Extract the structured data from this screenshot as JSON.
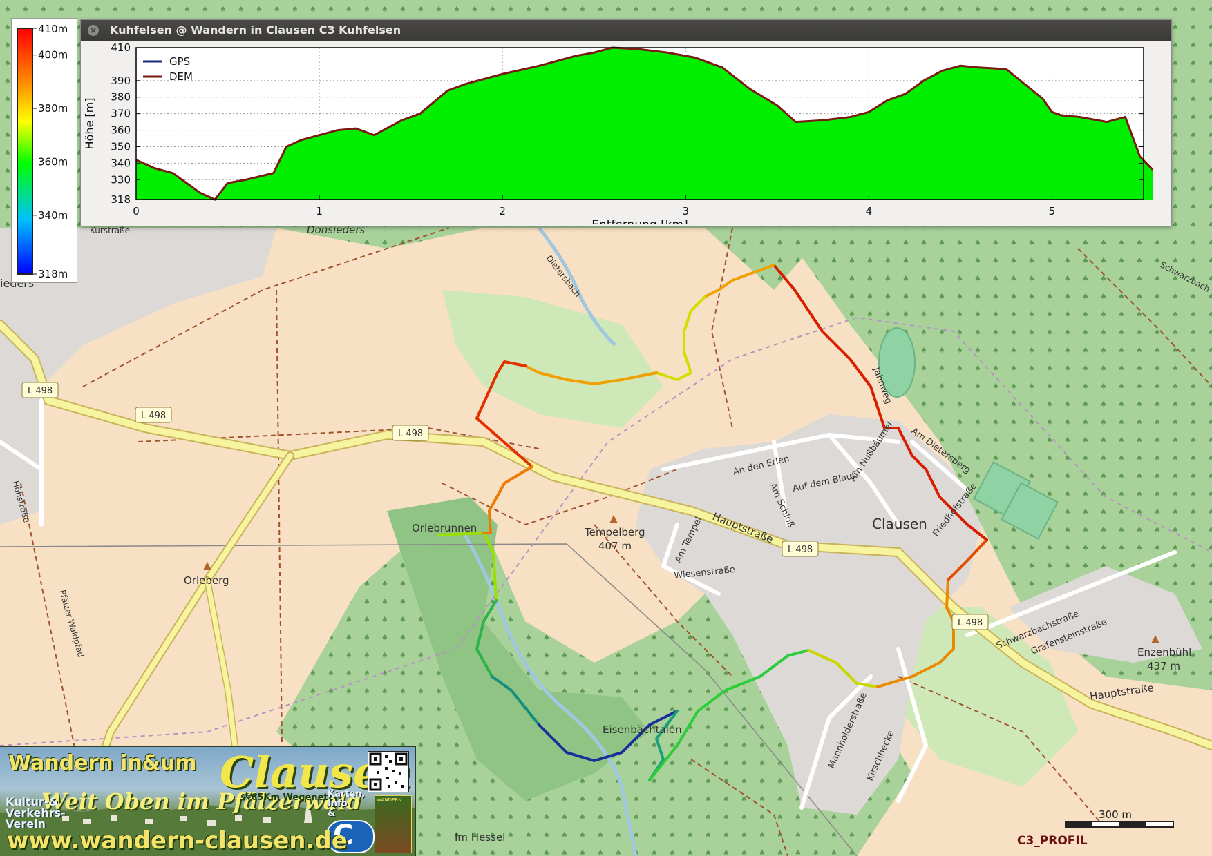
{
  "window": {
    "title": "Kuhfelsen @ Wandern in Clausen C3 Kuhfelsen",
    "close_glyph": "×"
  },
  "chart_data": {
    "type": "area",
    "xlabel": "Entfernung [km]",
    "ylabel": "Höhe [m]",
    "xlim": [
      0,
      5.5
    ],
    "ylim": [
      318,
      410
    ],
    "xticks": [
      0,
      1,
      2,
      3,
      4,
      5
    ],
    "yticks": [
      318,
      330,
      340,
      350,
      360,
      370,
      380,
      390,
      410
    ],
    "grid": true,
    "legend_position": "top-left",
    "series": [
      {
        "name": "GPS",
        "color": "#1c2a7a",
        "values": []
      },
      {
        "name": "DEM",
        "color": "#7a1a10",
        "fill": "#00ee00",
        "x": [
          0,
          0.1,
          0.2,
          0.35,
          0.43,
          0.5,
          0.6,
          0.75,
          0.82,
          0.9,
          1.0,
          1.1,
          1.2,
          1.3,
          1.45,
          1.55,
          1.7,
          1.8,
          2.0,
          2.2,
          2.4,
          2.5,
          2.6,
          2.75,
          2.9,
          3.05,
          3.2,
          3.35,
          3.5,
          3.6,
          3.75,
          3.9,
          4.0,
          4.1,
          4.2,
          4.3,
          4.4,
          4.5,
          4.6,
          4.75,
          4.85,
          4.95,
          5.0,
          5.05,
          5.15,
          5.25,
          5.3,
          5.4,
          5.48,
          5.55
        ],
        "y": [
          342,
          337,
          334,
          322,
          318,
          328,
          330,
          334,
          350,
          354,
          357,
          360,
          361,
          357,
          366,
          370,
          384,
          388,
          394,
          399,
          405,
          407,
          410,
          409,
          407,
          404,
          398,
          385,
          375,
          365,
          366,
          368,
          371,
          378,
          382,
          390,
          396,
          399,
          398,
          397,
          388,
          379,
          371,
          369,
          368,
          366,
          365,
          368,
          344,
          336
        ]
      }
    ]
  },
  "legend": {
    "labels": [
      "410m",
      "400m",
      "380m",
      "360m",
      "340m",
      "318m"
    ],
    "values": [
      410,
      400,
      380,
      360,
      340,
      318
    ],
    "min": 318,
    "max": 410
  },
  "map": {
    "places": [
      {
        "name": "Donsieders"
      },
      {
        "name": "Clausen"
      },
      {
        "name": "Orlebrunnen"
      },
      {
        "name": "Orleberg"
      },
      {
        "name": "Eisenbächtalen"
      },
      {
        "name": "Im Hessel"
      },
      {
        "name": "Tempelberg"
      },
      {
        "name": "Enzenbühl"
      }
    ],
    "peaks": [
      {
        "name": "Tempelberg",
        "elevation": "407 m"
      },
      {
        "name": "Enzenbühl",
        "elevation": "437 m"
      }
    ],
    "roads": [
      {
        "label": "L 498"
      },
      {
        "label": "L 498"
      },
      {
        "label": "L 498"
      },
      {
        "label": "L 498"
      },
      {
        "label": "L 498"
      },
      {
        "label": "Hauptstraße"
      },
      {
        "label": "Hauptstraße"
      },
      {
        "label": "Jahnweg"
      },
      {
        "label": "Am Dietersberg"
      },
      {
        "label": "Am Nußbäumel"
      },
      {
        "label": "An den Erlen"
      },
      {
        "label": "Am Schloß"
      },
      {
        "label": "Auf dem Blauf"
      },
      {
        "label": "Friedhofstraße"
      },
      {
        "label": "Am Tempel"
      },
      {
        "label": "Wiesenstraße"
      },
      {
        "label": "Schwarzbachstraße"
      },
      {
        "label": "Grafensteinstraße"
      },
      {
        "label": "Mannholderstraße"
      },
      {
        "label": "Kirschhecke"
      },
      {
        "label": "Pfälzer Waldpfad"
      },
      {
        "label": "Höhstraße"
      },
      {
        "label": "Dietersbach"
      },
      {
        "label": "Schwarzbach"
      },
      {
        "label": "Kurstraße"
      },
      {
        "label": "ieders"
      }
    ]
  },
  "banner": {
    "title": "Wandern in&um",
    "clausen": "Clausen",
    "slogan": "Weit Oben im Pfälzerwald",
    "network": "⁂65Km Wegenetz⁂",
    "verein": "Kultur-&\nVerkehrs-\nVerein",
    "karten": "Karten,\nInfo\n&",
    "logo_letter": "C",
    "app_label": "WANDERN",
    "url": "www.wandern-clausen.de"
  },
  "scale": {
    "label": "300 m"
  },
  "footer": {
    "profile_label": "C3_PROFIL"
  }
}
